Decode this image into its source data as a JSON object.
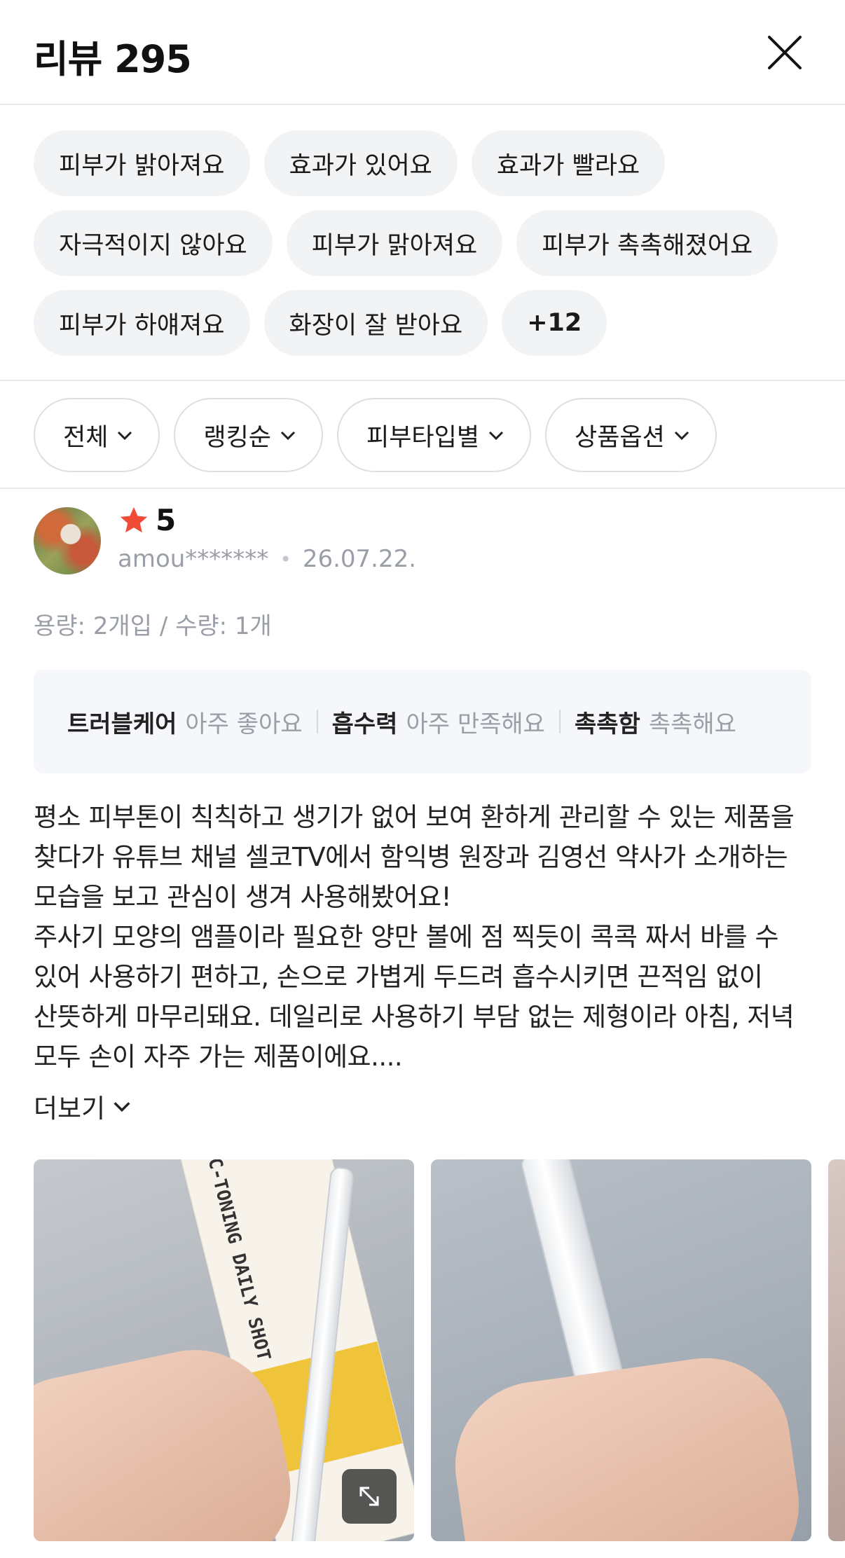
{
  "header": {
    "title": "리뷰 295",
    "close_icon": "close-icon"
  },
  "tags": [
    [
      "피부가 밝아져요",
      "효과가 있어요",
      "효과가 빨라요"
    ],
    [
      "자극적이지 않아요",
      "피부가 맑아져요",
      "피부가 촉촉해졌어요"
    ],
    [
      "피부가 하얘져요",
      "화장이 잘 받아요",
      "+12"
    ]
  ],
  "filters": [
    "전체",
    "랭킹순",
    "피부타입별",
    "상품옵션"
  ],
  "review": {
    "rating": "5",
    "username": "amou*******",
    "date": "26.07.22.",
    "option": "용량: 2개입 / 수량: 1개",
    "evaluations": [
      {
        "key": "트러블케어",
        "value": "아주 좋아요"
      },
      {
        "key": "흡수력",
        "value": "아주 만족해요"
      },
      {
        "key": "촉촉함",
        "value": "촉촉해요"
      }
    ],
    "text_lines": [
      "평소 피부톤이 칙칙하고 생기가 없어 보여 환하게 관리할 수 있는 제품을",
      "찾다가 유튜브 채널 셀코TV에서 함익병 원장과 김영선 약사가 소개하는",
      "모습을 보고 관심이 생겨 사용해봤어요!",
      "주사기 모양의 앰플이라 필요한 양만 볼에 점 찍듯이 콕콕 짜서 바를 수",
      "있어 사용하기 편하고, 손으로 가볍게 두드려 흡수시키면 끈적임 없이",
      "산뜻하게 마무리돼요. 데일리로 사용하기 부담 없는 제형이라 아침, 저녁",
      "모두 손이 자주 가는 제품이에요...."
    ],
    "more_label": "더보기",
    "photo_box_text": "C-TONING DAILY SHOT"
  },
  "colors": {
    "star": "#f04b37",
    "chip_bg": "#f2f3f5",
    "muted_text": "#9a9ea6"
  }
}
